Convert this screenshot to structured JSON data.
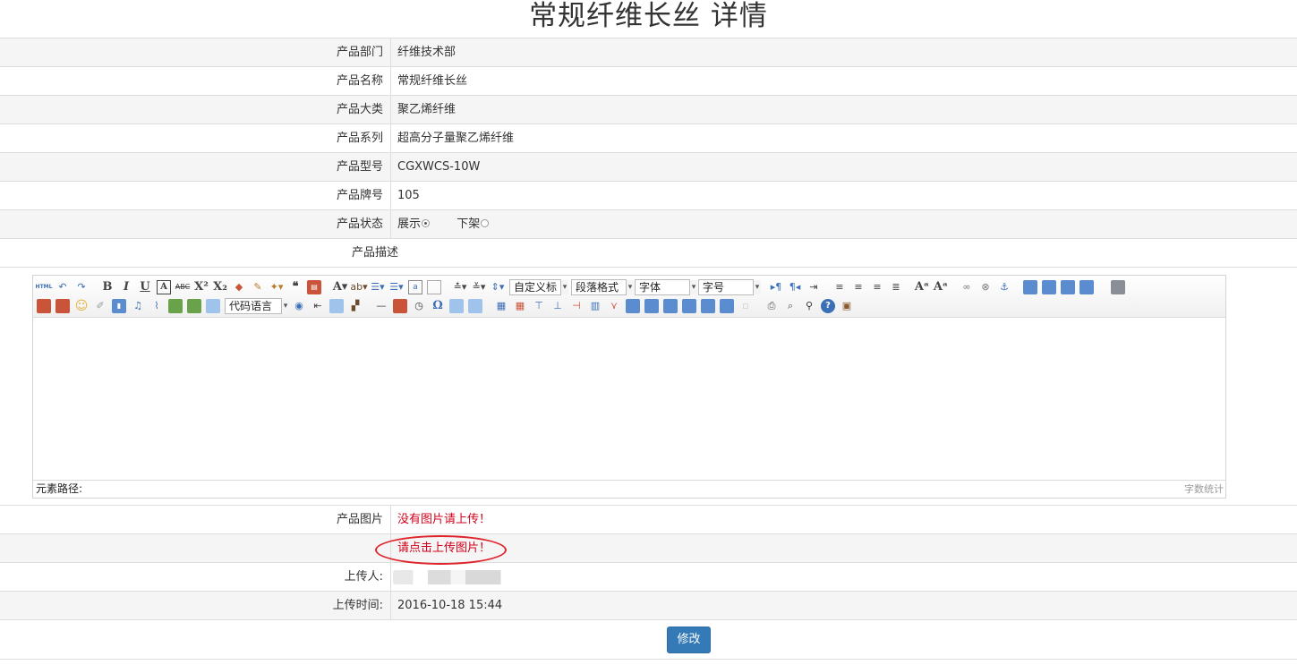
{
  "page": {
    "title": "常规纤维长丝 详情"
  },
  "fields": [
    {
      "label": "产品部门",
      "value": "纤维技术部"
    },
    {
      "label": "产品名称",
      "value": "常规纤维长丝"
    },
    {
      "label": "产品大类",
      "value": "聚乙烯纤维"
    },
    {
      "label": "产品系列",
      "value": "超高分子量聚乙烯纤维"
    },
    {
      "label": "产品型号",
      "value": "CGXWCS-10W"
    },
    {
      "label": "产品牌号",
      "value": "105"
    }
  ],
  "status": {
    "label": "产品状态",
    "option_show": "展示",
    "option_hide": "下架",
    "selected": "展示"
  },
  "description": {
    "label": "产品描述"
  },
  "editor": {
    "combos": {
      "custom_title": "自定义标",
      "paragraph": "段落格式",
      "font": "字体",
      "font_size": "字号",
      "code_lang": "代码语言"
    },
    "status_path": "元素路径:",
    "word_count": "字数统计",
    "icons": [
      "html-icon",
      "undo-icon",
      "redo-icon",
      "bold-icon",
      "italic-icon",
      "underline-icon",
      "fontborder-icon",
      "strikethrough-icon",
      "superscript-icon",
      "subscript-icon",
      "eraser-icon",
      "formatmatch-icon",
      "autotypeset-icon",
      "blockquote-icon",
      "pasteplain-icon",
      "forecolor-icon",
      "backcolor-icon",
      "orderedlist-icon",
      "unorderedlist-icon",
      "selectall-icon",
      "cleardoc-icon",
      "rowspacingtop-icon",
      "rowspacingbottom-icon",
      "lineheight-icon",
      "directionltr-icon",
      "directionrtl-icon",
      "indent-icon",
      "justifyleft-icon",
      "justifycenter-icon",
      "justifyright-icon",
      "justifyjustify-icon",
      "touppercase-icon",
      "tolowercase-icon",
      "link-icon",
      "unlink-icon",
      "anchor-icon",
      "imagenone-icon",
      "imageleft-icon",
      "imageright-icon",
      "imagecenter-icon",
      "fullscreen-icon"
    ]
  },
  "image": {
    "label": "产品图片",
    "no_image": "没有图片请上传！",
    "upload_link": "请点击上传图片！"
  },
  "uploader": {
    "label": "上传人:"
  },
  "upload_time": {
    "label": "上传时间:",
    "value": "2016-10-18 15:44"
  },
  "actions": {
    "edit": "修改"
  },
  "colors": {
    "primary": "#337ab7",
    "warning": "#d0021b",
    "annotation": "#e0242b"
  }
}
